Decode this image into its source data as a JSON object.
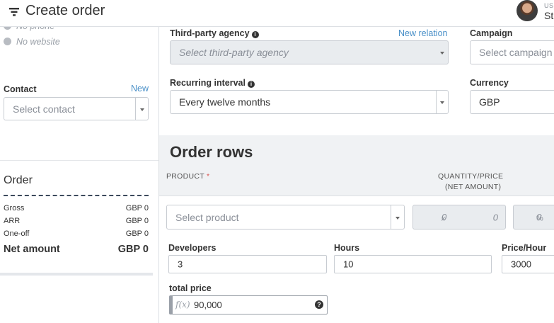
{
  "header": {
    "title": "Create order",
    "user_label": "USER",
    "user_name": "St"
  },
  "sidebar": {
    "phone": "No phone",
    "website": "No website",
    "contact_label": "Contact",
    "contact_new": "New",
    "contact_placeholder": "Select contact",
    "order_heading": "Order",
    "summary": [
      {
        "label": "Gross",
        "value": "GBP 0"
      },
      {
        "label": "ARR",
        "value": "GBP 0"
      },
      {
        "label": "One-off",
        "value": "GBP 0"
      }
    ],
    "net_label": "Net amount",
    "net_value": "GBP 0"
  },
  "form": {
    "agency_label": "Third-party agency",
    "agency_new": "New relation",
    "agency_placeholder": "Select third-party agency",
    "campaign_label": "Campaign",
    "campaign_placeholder": "Select campaign",
    "recurring_label": "Recurring interval",
    "recurring_value": "Every twelve months",
    "currency_label": "Currency",
    "currency_value": "GBP"
  },
  "order_rows": {
    "title": "Order rows",
    "col_product": "PRODUCT",
    "col_required": "*",
    "col_qty_line1": "QUANTITY/PRICE",
    "col_qty_line2": "(NET AMOUNT)",
    "product_placeholder": "Select product",
    "qty_value": "0",
    "qty_suffix": "x",
    "price_value": "0",
    "discount_value": "0",
    "discount_suffix": "%",
    "developers_label": "Developers",
    "developers_value": "3",
    "hours_label": "Hours",
    "hours_value": "10",
    "price_hour_label": "Price/Hour",
    "price_hour_value": "3000",
    "total_label": "total price",
    "total_fx": "f(x)",
    "total_value": "90,000",
    "help": "?"
  },
  "icons": {
    "filter": "filter-icon",
    "phone": "phone-icon",
    "globe": "globe-icon",
    "info": "info-icon",
    "help": "help-icon"
  }
}
